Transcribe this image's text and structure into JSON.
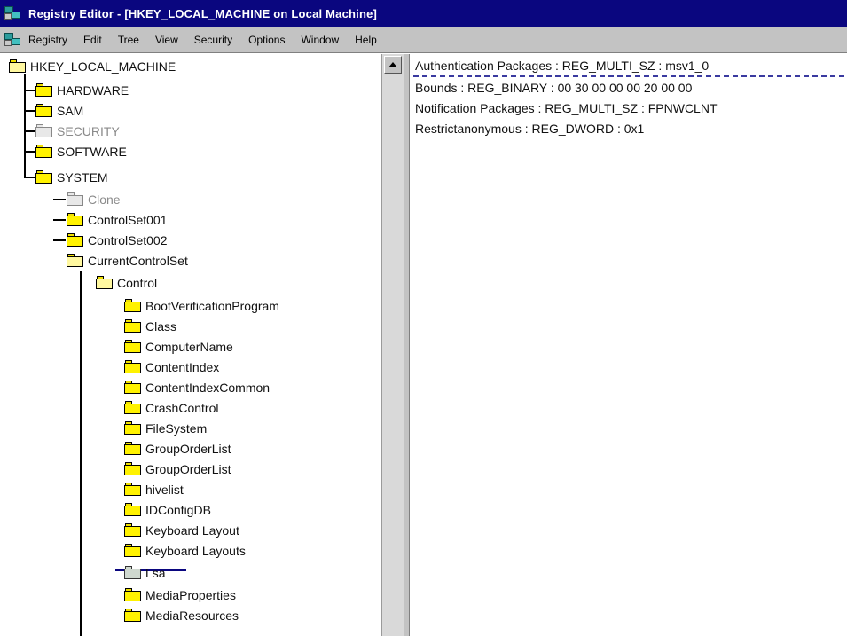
{
  "window": {
    "title": "Registry Editor - [HKEY_LOCAL_MACHINE on Local Machine]",
    "accent_color": "#0a067f",
    "chrome_color": "#c3c3c3"
  },
  "menubar": {
    "items": [
      "Registry",
      "Edit",
      "Tree",
      "View",
      "Security",
      "Options",
      "Window",
      "Help"
    ]
  },
  "tree": {
    "root": "HKEY_LOCAL_MACHINE",
    "nodes": [
      "HARDWARE",
      "SAM",
      "SECURITY",
      "SOFTWARE",
      "SYSTEM",
      "Clone",
      "ControlSet001",
      "ControlSet002",
      "CurrentControlSet",
      "Control",
      "BootVerificationProgram",
      "Class",
      "ComputerName",
      "ContentIndex",
      "ContentIndexCommon",
      "CrashControl",
      "FileSystem",
      "GroupOrderList",
      "GroupOrderList",
      "hivelist",
      "IDConfigDB",
      "Keyboard Layout",
      "Keyboard Layouts",
      "Lsa",
      "MediaProperties",
      "MediaResources"
    ]
  },
  "values": [
    "Authentication Packages : REG_MULTI_SZ : msv1_0",
    "Bounds : REG_BINARY : 00 30 00 00 00 20 00 00",
    "Notification Packages : REG_MULTI_SZ : FPNWCLNT",
    "Restrictanonymous : REG_DWORD : 0x1"
  ]
}
